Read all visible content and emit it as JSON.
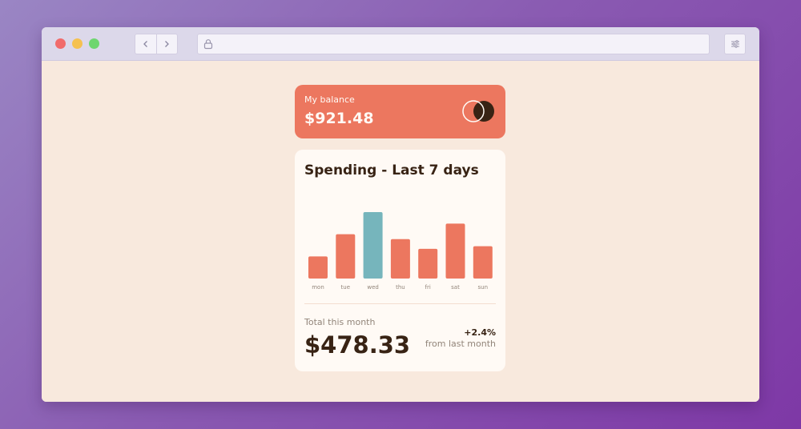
{
  "balance": {
    "label": "My balance",
    "amount": "$921.48"
  },
  "spending": {
    "title": "Spending - Last 7 days",
    "total_label": "Total this month",
    "total_amount": "$478.33",
    "change": "+2.4%",
    "change_label": "from last month"
  },
  "colors": {
    "bar": "#ec775f",
    "bar_highlight": "#76b5bc",
    "text_dark": "#382314",
    "text_muted": "#92857a"
  },
  "chart_data": {
    "type": "bar",
    "categories": [
      "mon",
      "tue",
      "wed",
      "thu",
      "fri",
      "sat",
      "sun"
    ],
    "values": [
      17.45,
      34.91,
      52.36,
      31.07,
      23.39,
      43.28,
      25.48
    ],
    "highlight": "wed",
    "grid": false,
    "legend": "none"
  },
  "icons": {
    "back": "chevron-left-icon",
    "forward": "chevron-right-icon",
    "lock": "lock-icon",
    "settings": "sliders-icon"
  }
}
